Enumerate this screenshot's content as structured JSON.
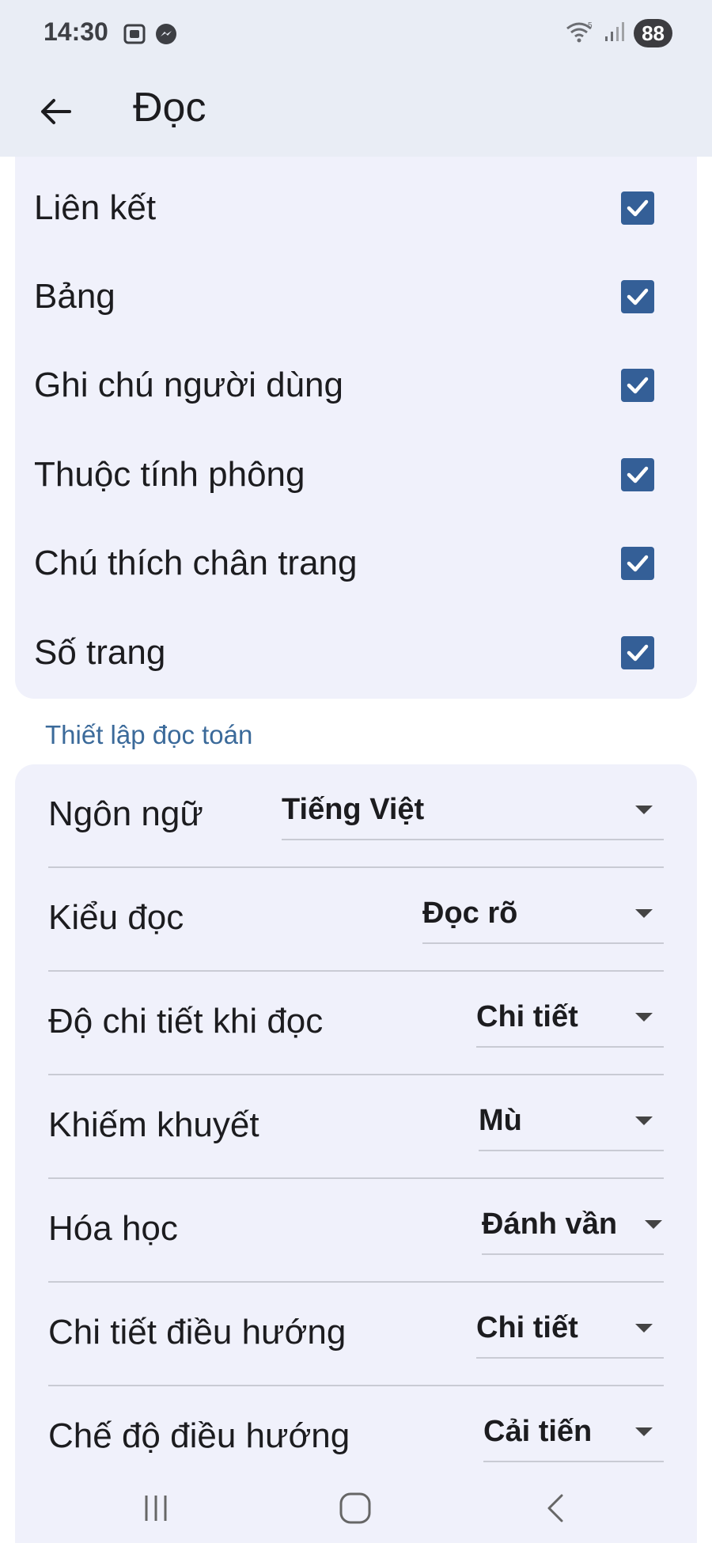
{
  "status_bar": {
    "time": "14:30",
    "left_icons": [
      "screenshot-icon",
      "messenger-icon"
    ],
    "right_icons": [
      "wifi-icon",
      "signal-icon"
    ],
    "battery": "88"
  },
  "app_bar": {
    "title": "Đọc",
    "back_icon": "arrow-left-icon"
  },
  "reading_options": [
    {
      "label": "Liên kết",
      "checked": true
    },
    {
      "label": "Bảng",
      "checked": true
    },
    {
      "label": "Ghi chú người dùng",
      "checked": true
    },
    {
      "label": "Thuộc tính phông",
      "checked": true
    },
    {
      "label": "Chú thích chân trang",
      "checked": true
    },
    {
      "label": "Số trang",
      "checked": true
    }
  ],
  "math_section": {
    "header": "Thiết lập đọc toán",
    "settings": [
      {
        "label": "Ngôn ngữ",
        "value": "Tiếng Việt"
      },
      {
        "label": "Kiểu đọc",
        "value": "Đọc rõ"
      },
      {
        "label": "Độ chi tiết khi đọc",
        "value": "Chi tiết"
      },
      {
        "label": "Khiếm khuyết",
        "value": "Mù"
      },
      {
        "label": "Hóa học",
        "value": "Đánh vần"
      },
      {
        "label": "Chi tiết điều hướng",
        "value": "Chi tiết"
      },
      {
        "label": "Chế độ điều hướng",
        "value": "Cải tiến"
      }
    ]
  },
  "nav_bar": {
    "icons": [
      "recents-icon",
      "home-icon",
      "back-icon"
    ]
  },
  "colors": {
    "accent": "#345f97",
    "section_header": "#3b6a9a",
    "card_bg": "#f0f1fb",
    "appbar_bg": "#e9edf5"
  }
}
